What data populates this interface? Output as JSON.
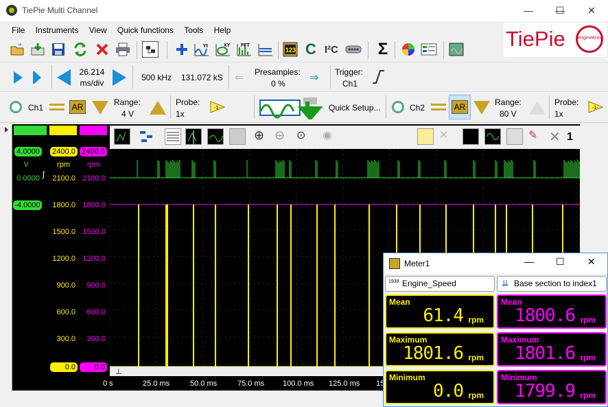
{
  "app": {
    "title": "TiePie Multi Channel",
    "logo": "TiePie",
    "logo_seal": "engineering"
  },
  "menu": [
    "File",
    "Instruments",
    "View",
    "Quick functions",
    "Tools",
    "Help"
  ],
  "toolbar_icons": [
    "open-icon",
    "save-download-icon",
    "save-icon",
    "refresh-icon",
    "close-red-icon",
    "print-icon",
    "instrument-icon",
    "add-icon",
    "yt-graph-icon",
    "xy-graph-icon",
    "fft-graph-icon",
    "line-graph-icon",
    "meter-icon",
    "c-icon",
    "i2c-icon",
    "serial-icon",
    "sigma-icon",
    "color-wheel-icon",
    "channel-list-icon",
    "screen-icon"
  ],
  "acq": {
    "timebase_value": "26.214",
    "timebase_unit": "ms/div",
    "sample_rate": "500 kHz",
    "record_length": "131.072 kS",
    "presamples_label": "Presamples:",
    "presamples_value": "0 %",
    "trigger_label": "Trigger:",
    "trigger_source": "Ch1"
  },
  "ch1": {
    "name": "Ch1",
    "ar": "AR",
    "range_label": "Range:",
    "range_value": "4 V",
    "probe_label": "Probe:",
    "probe_value": "1x"
  },
  "quick_setup": "Quick Setup...",
  "ch2": {
    "name": "Ch2",
    "ar": "AR",
    "range_label": "Range:",
    "range_value": "80 V",
    "probe_label": "Probe:",
    "probe_value": "1x"
  },
  "scope": {
    "col1": {
      "top": "4.0000",
      "unit": "V",
      "mid": "0.0000",
      "bottom": "-4.0000",
      "color": "#33dd33"
    },
    "col2": {
      "top": "2400.0",
      "unit": "rpm",
      "bottom": "0.0",
      "color": "#ffee00",
      "ticks": [
        "2100.0",
        "1800.0",
        "1500.0",
        "1200.0",
        "900.0",
        "600.0",
        "300.0"
      ]
    },
    "col3": {
      "top": "2400.0",
      "unit": "rpm",
      "bottom": "0.0",
      "color": "#ff00ff",
      "ticks": [
        "2100.0",
        "1800.0",
        "1500.0",
        "1200.0",
        "900.0",
        "600.0",
        "300.0"
      ]
    },
    "time_labels": [
      "0 s",
      "25.0 ms",
      "50.0 ms",
      "75.0 ms",
      "100.0 ms",
      "125.0 ms",
      "15"
    ],
    "toolbar_right_label": "1"
  },
  "meter": {
    "title": "Meter1",
    "source": "Engine_Speed",
    "source_tag": "1939",
    "base": "Base section to index1",
    "left": [
      {
        "label": "Mean",
        "value": "61.4",
        "unit": "rpm"
      },
      {
        "label": "Maximum",
        "value": "1801.6",
        "unit": "rpm"
      },
      {
        "label": "Minimum",
        "value": "0.0",
        "unit": "rpm"
      }
    ],
    "right": [
      {
        "label": "Mean",
        "value": "1800.6",
        "unit": "rpm"
      },
      {
        "label": "Maximum",
        "value": "1801.6",
        "unit": "rpm"
      },
      {
        "label": "Minimum",
        "value": "1799.9",
        "unit": "rpm"
      }
    ],
    "colors": {
      "left": "#ffee00",
      "right": "#ff00ff"
    }
  }
}
